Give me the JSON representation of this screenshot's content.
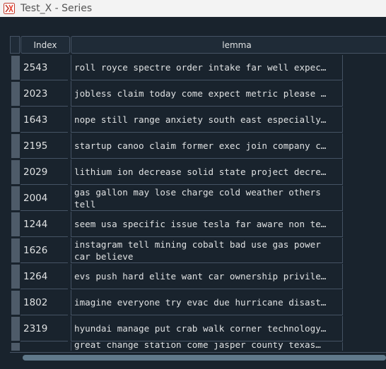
{
  "window": {
    "title": "Test_X - Series"
  },
  "table": {
    "headers": {
      "index": "Index",
      "lemma": "lemma"
    },
    "rows": [
      {
        "index": "2543",
        "lemma": "roll royce spectre order intake far well expec…"
      },
      {
        "index": "2023",
        "lemma": "jobless claim today come expect metric please …"
      },
      {
        "index": "1643",
        "lemma": "nope still range anxiety south east especially…"
      },
      {
        "index": "2195",
        "lemma": "startup canoo claim former exec join company c…"
      },
      {
        "index": "2029",
        "lemma": "lithium ion decrease solid state project decre…"
      },
      {
        "index": "2004",
        "lemma": "gas gallon may lose charge cold weather others tell"
      },
      {
        "index": "1244",
        "lemma": "seem usa specific issue tesla far aware non te…"
      },
      {
        "index": "1626",
        "lemma": "instagram tell mining cobalt bad use gas power car believe"
      },
      {
        "index": "1264",
        "lemma": "evs push hard elite want car ownership privile…"
      },
      {
        "index": "1802",
        "lemma": "imagine everyone try evac due hurricane disast…"
      },
      {
        "index": "2319",
        "lemma": "hyundai manage put crab walk corner technology…"
      },
      {
        "index": "",
        "lemma": "great change station come jasper county texas…"
      }
    ]
  }
}
